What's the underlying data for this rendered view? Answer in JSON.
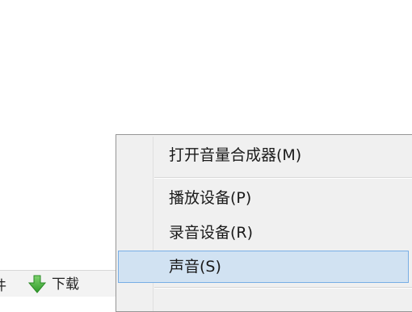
{
  "toolbar": {
    "prev_label": "件",
    "download_label": "下载",
    "download_icon": "download-arrow-icon",
    "download_icon_color": "#3cb034"
  },
  "context_menu": {
    "items": [
      {
        "label": "打开音量合成器(M)"
      },
      {
        "label": "播放设备(P)"
      },
      {
        "label": "录音设备(R)"
      },
      {
        "label": "声音(S)",
        "highlighted": true
      }
    ],
    "highlight_color": "#d1e2f2",
    "highlight_border": "#78aee5"
  }
}
